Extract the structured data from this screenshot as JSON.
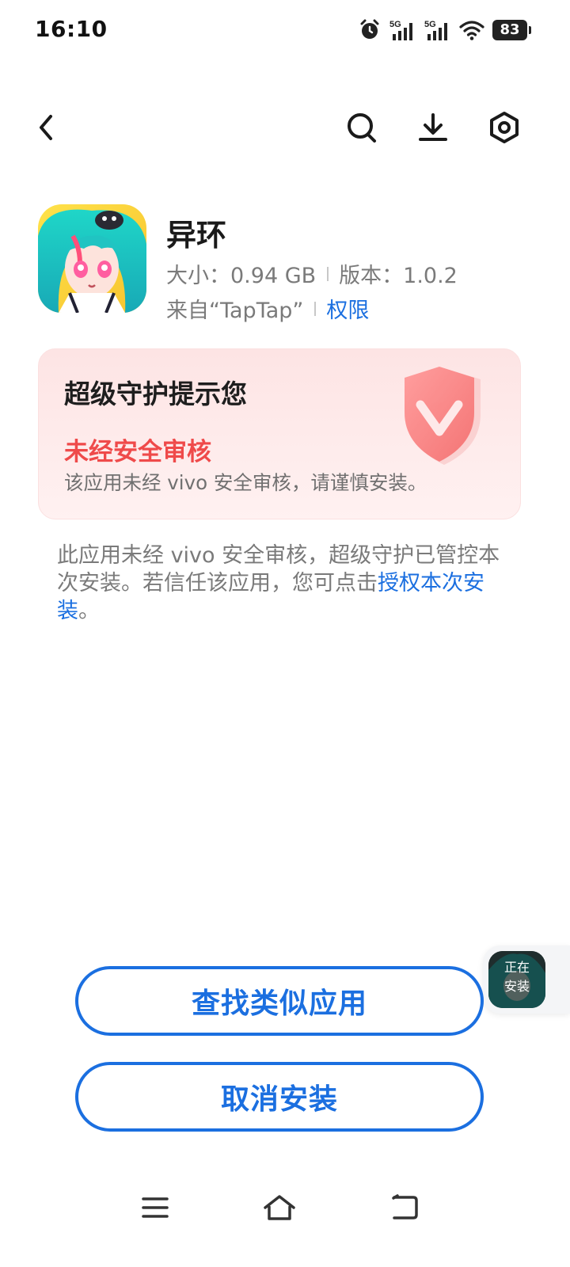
{
  "status_bar": {
    "time": "16:10",
    "network_1": "5G",
    "network_2": "5G",
    "battery": "83",
    "icons": [
      "alarm-icon",
      "signal-5g-icon",
      "signal-5g-icon",
      "wifi-icon",
      "battery-icon"
    ]
  },
  "nav": {
    "icons": [
      "back-arrow-icon",
      "search-icon",
      "download-icon",
      "settings-hexagon-icon"
    ]
  },
  "app": {
    "name": "异环",
    "size_label": "大小：0.94 GB",
    "version_label": "版本：1.0.2",
    "source_label": "来自“TapTap”",
    "permissions_link": "权限"
  },
  "warning": {
    "title": "超级守护提示您",
    "status": "未经安全审核",
    "description": "该应用未经 vivo 安全审核，请谨慎安装。",
    "colors": {
      "status": "#ef4a4a",
      "card_bg": "#fde4e4"
    }
  },
  "notice": {
    "text": "此应用未经 vivo 安全审核，超级守护已管控本次安装。若信任该应用，您可点击",
    "link": "授权本次安装",
    "end": "。"
  },
  "floating": {
    "line1": "正在",
    "line2": "安装"
  },
  "buttons": {
    "find_similar": "查找类似应用",
    "cancel_install": "取消安装"
  },
  "system_nav": {
    "icons": [
      "menu-icon",
      "home-icon",
      "back-icon"
    ]
  },
  "colors": {
    "accent": "#1b6fe0",
    "danger": "#ef4a4a"
  }
}
